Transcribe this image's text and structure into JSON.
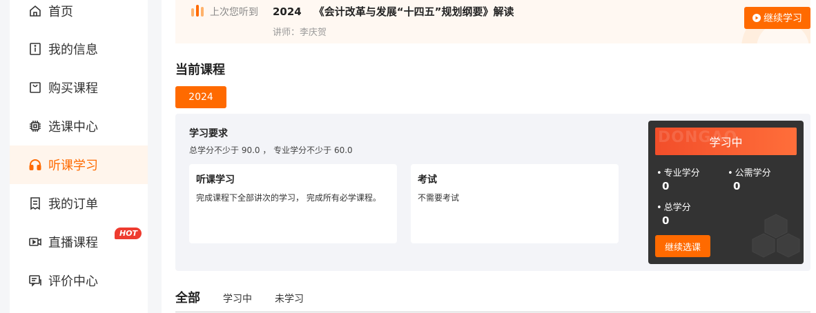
{
  "sidebar": {
    "items": [
      {
        "label": "首页",
        "icon": "home-icon"
      },
      {
        "label": "我的信息",
        "icon": "info-icon"
      },
      {
        "label": "购买课程",
        "icon": "shopping-bag-icon"
      },
      {
        "label": "选课中心",
        "icon": "chip-icon"
      },
      {
        "label": "听课学习",
        "icon": "headphones-icon",
        "active": true
      },
      {
        "label": "我的订单",
        "icon": "order-icon"
      },
      {
        "label": "直播课程",
        "icon": "video-icon",
        "badge": "HOT"
      },
      {
        "label": "评价中心",
        "icon": "comment-icon"
      }
    ]
  },
  "last_listened": {
    "label": "上次您听到",
    "year": "2024",
    "course_title": "《会计改革与发展“十四五”规划纲要》解读",
    "teacher": "讲师：李庆贺",
    "continue_label": "继续学习"
  },
  "current_courses": {
    "title": "当前课程",
    "year_tab": "2024",
    "requirements_title": "学习要求",
    "requirements_desc": "总学分不少于 90.0 ，  专业学分不少于 60.0",
    "cards": [
      {
        "title": "听课学习",
        "desc": "完成课程下全部讲次的学习， 完成所有必学课程。"
      },
      {
        "title": "考试",
        "desc": "不需要考试"
      }
    ],
    "status": {
      "heading": "学习中",
      "watermark": "DONGAO",
      "professional_label": "专业学分",
      "professional_value": "0",
      "public_label": "公需学分",
      "public_value": "0",
      "total_label": "总学分",
      "total_value": "0",
      "choose_button": "继续选课"
    }
  },
  "filters": {
    "all": "全部",
    "studying": "学习中",
    "not_studied": "未学习"
  },
  "colors": {
    "accent": "#ff6a00",
    "hot": "#ee3b2f",
    "status_card": "#333333"
  }
}
